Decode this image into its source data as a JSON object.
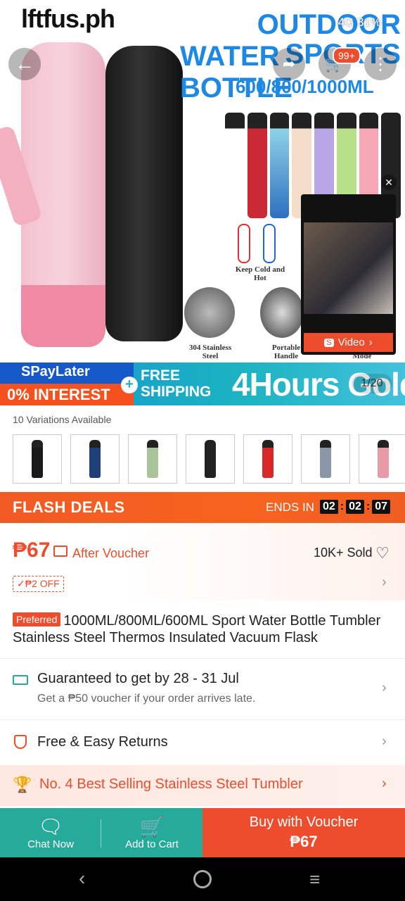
{
  "hero": {
    "watermark": "lftfus.ph",
    "title_line1": "OUTDOOR SPORTS",
    "title_line2": "WATER BOTTLE",
    "capacity": "600/800/1000ML",
    "status": "4G  31%",
    "cart_count": "99+",
    "features": [
      "Keep Cold and Hot",
      "304 Stainless Steel",
      "Portable Handle",
      "Mode"
    ],
    "video_label": "Video",
    "image_counter": "1/20"
  },
  "banner": {
    "spay_title": "SPayLater",
    "interest": "0% INTEREST",
    "free": "FREE",
    "shipping": "SHIPPING",
    "hours": "4Hours Gold"
  },
  "variations": {
    "label": "10 Variations Available",
    "colors": [
      "#1a1a1a",
      "#1f3f7a",
      "#a9c49a",
      "#222222",
      "#d8282a",
      "#8b97a7",
      "#e89aa8"
    ]
  },
  "flash": {
    "title": "FLASH DEALS",
    "ends_label": "ENDS IN",
    "hh": "02",
    "mm": "02",
    "ss": "07"
  },
  "price": {
    "amount": "₱67",
    "after_voucher": "After Voucher",
    "sold": "10K+ Sold",
    "discount_tag": "✓₱2 OFF"
  },
  "product": {
    "preferred": "Preferred",
    "title": "1000ML/800ML/600ML Sport Water Bottle Tumbler Stainless Steel Thermos Insulated Vacuum Flask"
  },
  "shipping": {
    "main": "Guaranteed to get by 28 - 31 Jul",
    "sub": "Get a ₱50 voucher if your order arrives late."
  },
  "returns": {
    "label": "Free & Easy Returns"
  },
  "best": {
    "label": "No. 4 Best Selling Stainless Steel Tumbler"
  },
  "bottom": {
    "chat": "Chat Now",
    "cart": "Add to Cart",
    "buy_line1": "Buy with Voucher",
    "buy_line2": "₱67"
  },
  "colors": {
    "accent": "#ee4d2d",
    "teal": "#26aa99"
  }
}
